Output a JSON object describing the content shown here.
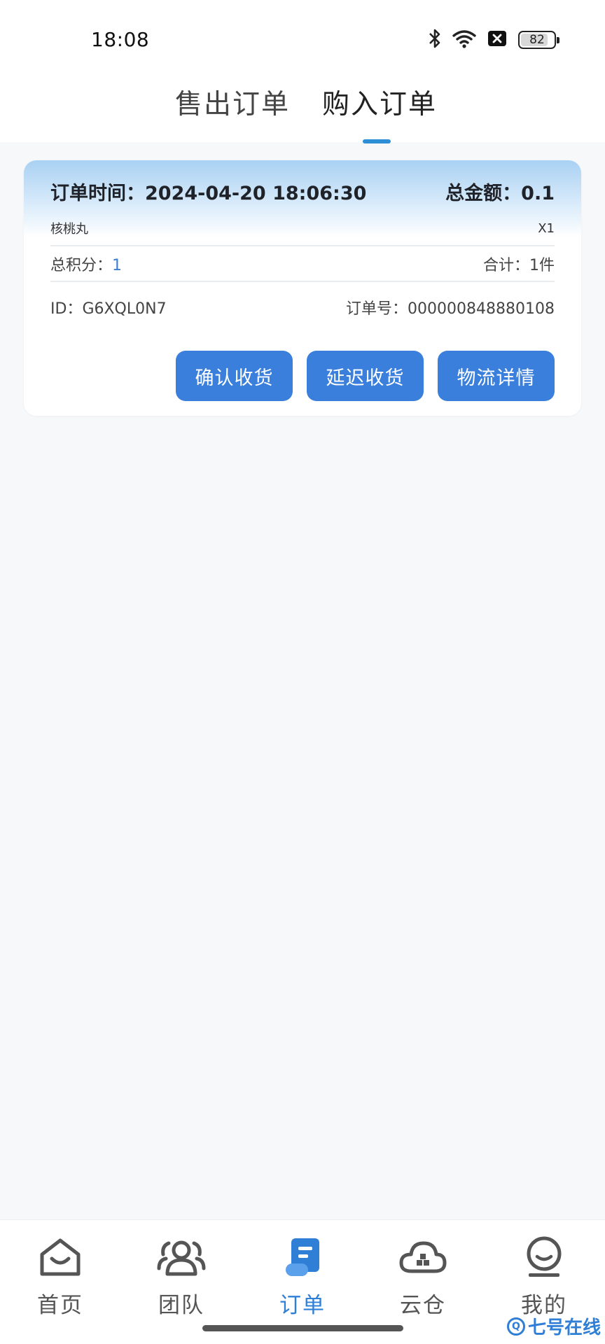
{
  "status_bar": {
    "time": "18:08",
    "icons": [
      "bluetooth-icon",
      "wifi-icon",
      "sim-off-icon"
    ],
    "battery": "82",
    "battery_level": 0.82
  },
  "tabs": {
    "sell": "售出订单",
    "buy": "购入订单",
    "active": "buy"
  },
  "order": {
    "time_label": "订单时间：",
    "time_value": "2024-04-20 18:06:30",
    "total_label": "总金额：",
    "total_value": "0.1",
    "item_name": "核桃丸",
    "item_qty": "X1",
    "points_label": "总积分：",
    "points_value": "1",
    "count_label": "合计：",
    "count_value": "1件",
    "id_label": "ID：",
    "id_value": "G6XQL0N7",
    "order_no_label": "订单号：",
    "order_no_value": "000000848880108",
    "actions": {
      "confirm": "确认收货",
      "delay": "延迟收货",
      "logistics": "物流详情"
    }
  },
  "bottom_nav": {
    "home": "首页",
    "team": "团队",
    "order": "订单",
    "cloud": "云仓",
    "me": "我的",
    "active": "order"
  },
  "watermark": {
    "text": "七号在线"
  },
  "colors": {
    "accent": "#3a7fdc",
    "tab_indicator": "#2e8fd6",
    "active_nav": "#2f7fd6",
    "background": "#f7f8fa"
  }
}
